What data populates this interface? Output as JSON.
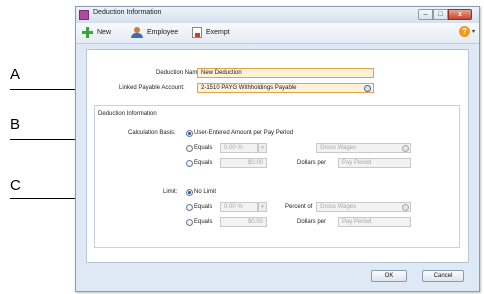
{
  "callouts": [
    "A",
    "B",
    "C"
  ],
  "window": {
    "title": "Deduction Information"
  },
  "titlebar_buttons": {
    "minimize": "–",
    "maximize": "□",
    "close": "x"
  },
  "toolbar": {
    "new_label": "New",
    "employee_label": "Employee",
    "exempt_label": "Exempt",
    "help_symbol": "?",
    "help_arrow": "▾"
  },
  "form": {
    "name_label": "Deduction Name:",
    "name_value": "New Deduction",
    "account_label": "Linked Payable Account:",
    "account_value": "2-1510 PAYG Withholdings Payable",
    "section_title": "Deduction Information",
    "calc": {
      "label": "Calculation Basis:",
      "option1": "User-Entered Amount per Pay Period",
      "equals": "Equals",
      "percent_value": "0.00 %",
      "percent_of": "Gross Wages",
      "amount_value": "$0.00",
      "dollars_per": "Dollars per",
      "period_value": "Pay Period"
    },
    "limit": {
      "label": "Limit:",
      "option1": "No Limit",
      "equals": "Equals",
      "percent_value": "0.00 %",
      "percent_of_label": "Percent of",
      "percent_of": "Gross Wages",
      "amount_value": "$0.00",
      "dollars_per": "Dollars per",
      "period_value": "Pay Period"
    },
    "dropdown_arrow": "▾"
  },
  "footer": {
    "ok_label": "OK",
    "cancel_label": "Cancel"
  }
}
